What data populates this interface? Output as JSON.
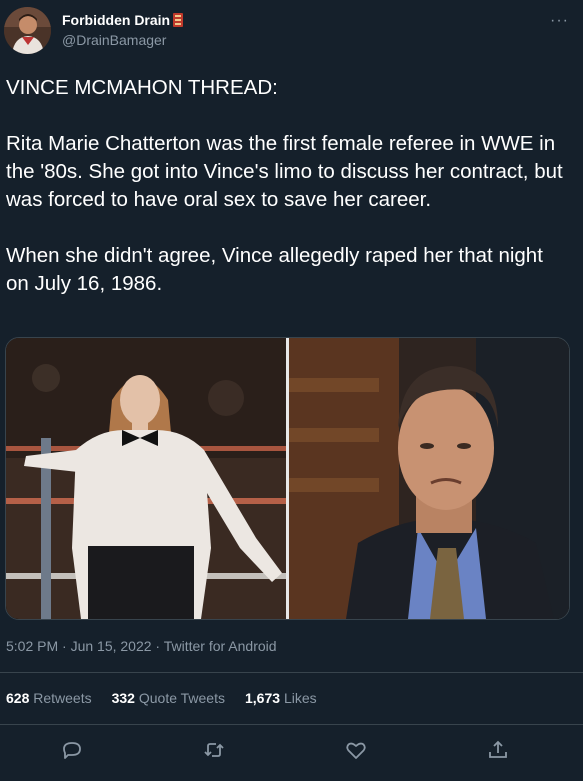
{
  "author": {
    "display_name": "Forbidden Drain",
    "handle": "@DrainBamager",
    "emoji_icon": "brick-emoji-icon"
  },
  "tweet": {
    "text": "VINCE MCMAHON THREAD:\n\nRita Marie Chatterton was the first female referee in WWE in the '80s. She got into Vince's limo to discuss her contract, but was forced to have oral sex to save her career.\n\nWhen she didn't agree, Vince allegedly raped her that night on July 16, 1986.",
    "timestamp": "5:02 PM · Jun 15, 2022 · Twitter for Android"
  },
  "stats": {
    "retweets_count": "628",
    "retweets_label": "Retweets",
    "quotes_count": "332",
    "quotes_label": "Quote Tweets",
    "likes_count": "1,673",
    "likes_label": "Likes"
  },
  "actions": [
    "reply-icon",
    "retweet-icon",
    "like-icon",
    "share-icon"
  ],
  "colors": {
    "background": "#15202b",
    "text": "#ffffff",
    "secondary": "#8b98a5",
    "border": "#38444d"
  }
}
